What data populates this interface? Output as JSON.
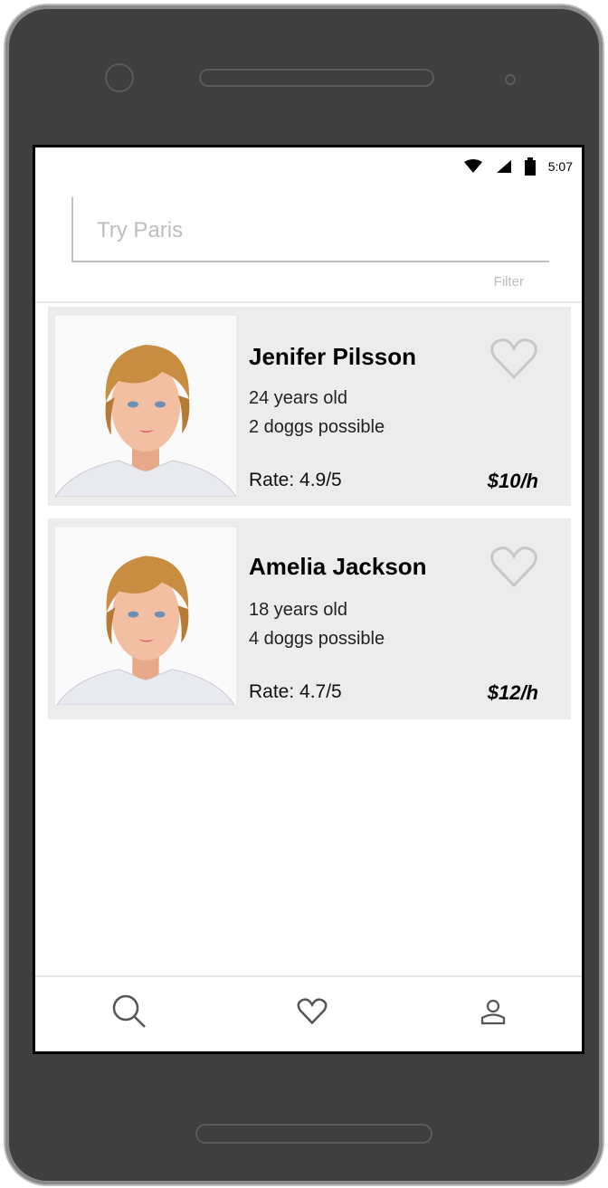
{
  "status_bar": {
    "time": "5:07",
    "icons": [
      "wifi-icon",
      "signal-icon",
      "battery-icon"
    ]
  },
  "search": {
    "placeholder": "Try Paris",
    "filter_label": "Filter"
  },
  "sitters": [
    {
      "name": "Jenifer Pilsson",
      "age": "24 years old",
      "dogs": "2 doggs possible",
      "rate": "Rate: 4.9/5",
      "price": "$10/h",
      "favorite": false
    },
    {
      "name": "Amelia Jackson",
      "age": "18 years old",
      "dogs": "4 doggs possible",
      "rate": "Rate: 4.7/5",
      "price": "$12/h",
      "favorite": false
    }
  ],
  "tabs": [
    {
      "name": "search",
      "icon": "search-icon"
    },
    {
      "name": "favorites",
      "icon": "heart-icon"
    },
    {
      "name": "profile",
      "icon": "user-icon"
    }
  ],
  "colors": {
    "card_bg": "#ececec",
    "phone_body": "#3f3f3f",
    "accent": "#000000"
  }
}
